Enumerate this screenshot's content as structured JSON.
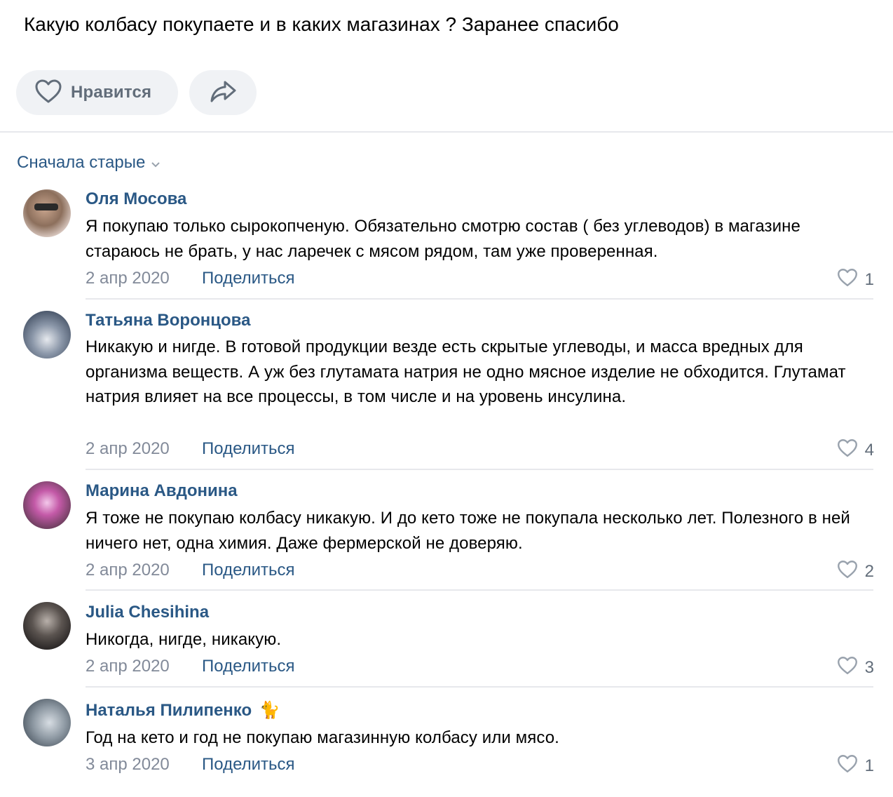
{
  "post": {
    "text": "Какую колбасу покупаете и в каких магазинах ? Заранее спасибо",
    "like_label": "Нравится"
  },
  "sort_label": "Сначала старые",
  "share_label": "Поделиться",
  "colors": {
    "link": "#2a5885",
    "muted": "#828a99",
    "pill_bg": "#f0f2f5",
    "divider": "#e7e8ec"
  },
  "comments": [
    {
      "author": "Оля Мосова",
      "text": "Я покупаю только сырокопченую. Обязательно смотрю состав ( без углеводов) в магазине стараюсь не брать, у нас ларечек с мясом рядом, там уже проверенная.",
      "date": "2 апр 2020",
      "likes": "1"
    },
    {
      "author": "Татьяна Воронцова",
      "text": "Никакую и нигде. В готовой продукции везде есть скрытые углеводы, и масса вредных для организма веществ. А уж без глутамата натрия не одно мясное изделие не обходится. Глутамат натрия влияет на все процессы, в том числе и на уровень инсулина.",
      "date": "2 апр 2020",
      "likes": "4"
    },
    {
      "author": "Марина Авдонина",
      "text": "Я тоже не покупаю колбасу никакую. И до кето тоже не покупала несколько лет. Полезного в ней ничего нет, одна химия. Даже фермерской не доверяю.",
      "date": "2 апр 2020",
      "likes": "2"
    },
    {
      "author": "Julia Chesihina",
      "text": "Никогда, нигде, никакую.",
      "date": "2 апр 2020",
      "likes": "3"
    },
    {
      "author": "Наталья Пилипенко",
      "author_emoji": "🐈",
      "text": "Год на кето и год не покупаю магазинную колбасу или мясо.",
      "date": "3 апр 2020",
      "likes": "1"
    }
  ]
}
